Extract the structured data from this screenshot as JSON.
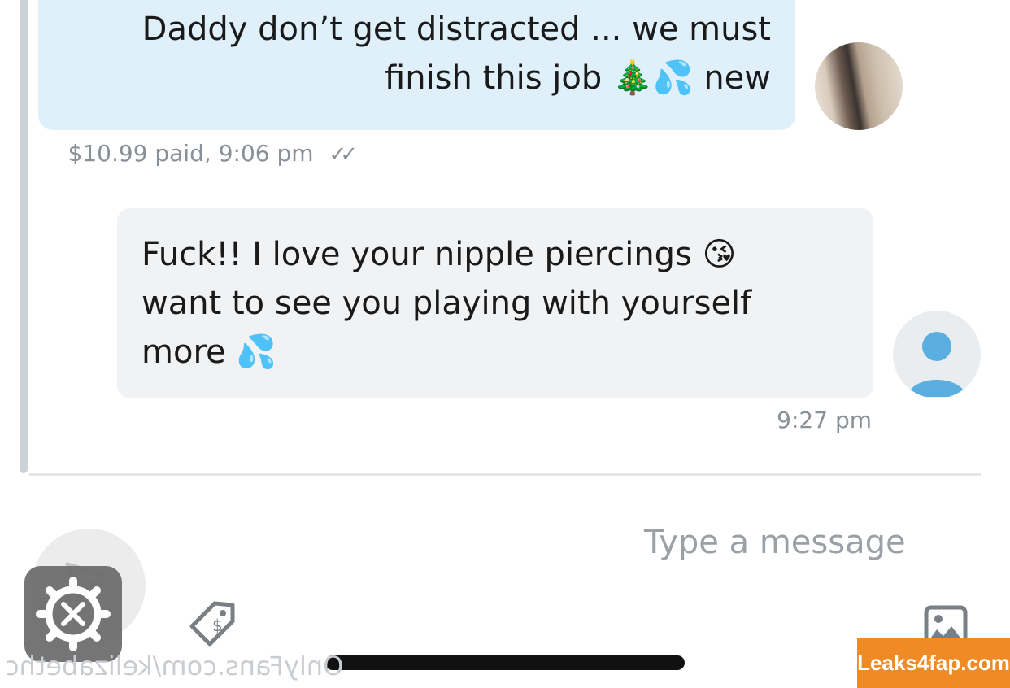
{
  "conversation": {
    "messages": [
      {
        "line1": "Daddy don’t get distracted ... we must",
        "line2_text": "finish this job",
        "line2_emoji": "🎄💦",
        "line2_end": "new",
        "meta": "$10.99 paid, 9:06 pm",
        "ticks": "✓✓"
      },
      {
        "line1": "Fuck!! I love your nipple piercings",
        "line1_emoji": "😘",
        "line2": "want to see you playing with yourself",
        "line3": "more",
        "line3_emoji": "💦",
        "meta": "9:27 pm"
      }
    ]
  },
  "composer": {
    "placeholder": "Type a message"
  },
  "watermark": {
    "url": "OnlyFans.com/kelizabethc",
    "badge": "Leaks4fap.com"
  },
  "colors": {
    "own_bubble": "#dff0fb",
    "other_bubble": "#f0f2f4",
    "badge": "#f08a24"
  },
  "icons": [
    "image-icon",
    "price-tag-icon",
    "send-icon",
    "settings-gear-icon",
    "default-avatar-icon"
  ]
}
